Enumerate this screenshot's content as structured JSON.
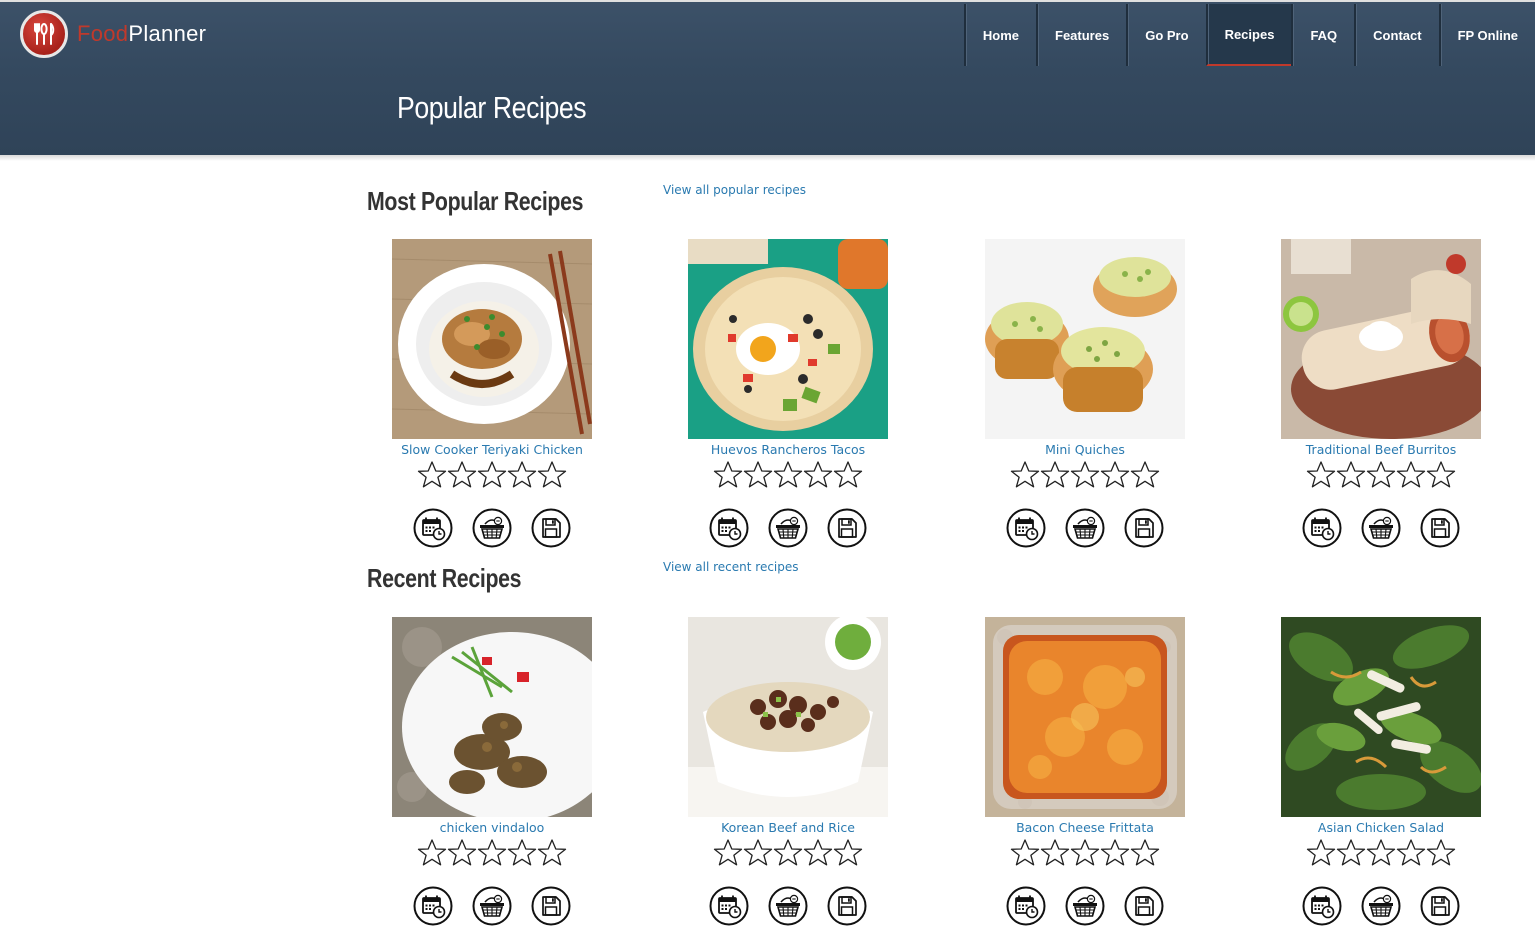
{
  "brand": {
    "food": "Food",
    "planner": "Planner"
  },
  "nav": [
    {
      "label": "Home",
      "active": false
    },
    {
      "label": "Features",
      "active": false
    },
    {
      "label": "Go Pro",
      "active": false
    },
    {
      "label": "Recipes",
      "active": true
    },
    {
      "label": "FAQ",
      "active": false
    },
    {
      "label": "Contact",
      "active": false
    },
    {
      "label": "FP Online",
      "active": false
    }
  ],
  "page_title": "Popular Recipes",
  "popular": {
    "title": "Most Popular Recipes",
    "view_all": "View all popular recipes",
    "recipes": [
      {
        "name": "Slow Cooker Teriyaki Chicken",
        "rating": 0
      },
      {
        "name": "Huevos Rancheros Tacos",
        "rating": 0
      },
      {
        "name": "Mini Quiches",
        "rating": 0
      },
      {
        "name": "Traditional Beef Burritos",
        "rating": 0
      }
    ]
  },
  "recent": {
    "title": "Recent Recipes",
    "view_all": "View all recent recipes",
    "recipes": [
      {
        "name": "chicken vindaloo",
        "rating": 0
      },
      {
        "name": "Korean Beef and Rice",
        "rating": 0
      },
      {
        "name": "Bacon Cheese Frittata",
        "rating": 0
      },
      {
        "name": "Asian Chicken Salad",
        "rating": 0
      }
    ]
  },
  "icons": {
    "plan": "calendar-clock-icon",
    "shop": "shopping-basket-icon",
    "save": "floppy-disk-icon"
  },
  "colors": {
    "header": "#34495f",
    "brand_red": "#c0392b",
    "link": "#2a7ab0"
  }
}
